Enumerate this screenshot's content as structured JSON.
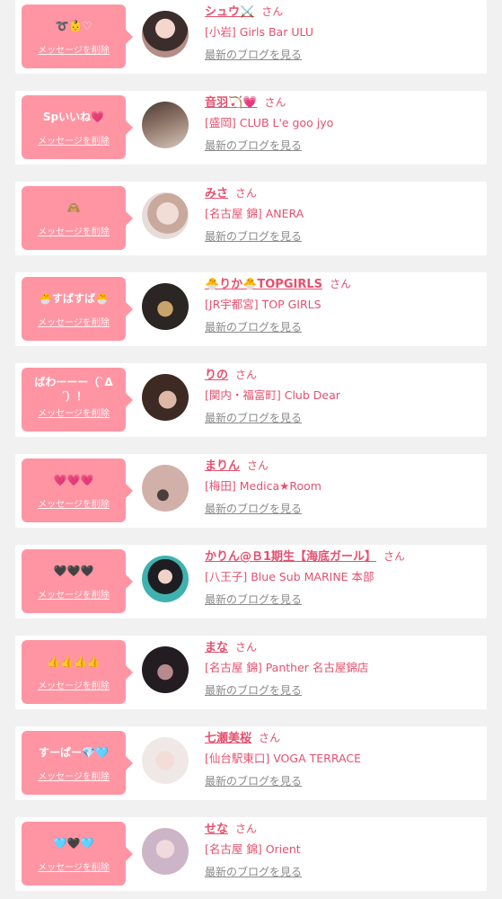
{
  "delete_label": "メッセージを削除",
  "blog_label": "最新のブログを見る",
  "honorific": "さん",
  "colors": {
    "accent": "#e5506e",
    "bubble": "#ff95a3",
    "page_bg": "#f1f1f1",
    "card_bg": "#ffffff"
  },
  "items": [
    {
      "message": "➰👶♡",
      "name": "シュウ⚔️",
      "shop": "[小岩] Girls Bar ULU"
    },
    {
      "message": "Spいいね💗",
      "name": "音羽🏹💗",
      "shop": "[盛岡] CLUB L'e goo jyo"
    },
    {
      "message": "🙈",
      "name": "みさ",
      "shop": "[名古屋 錦] ANERA"
    },
    {
      "message": "🐣すばすば🐣",
      "name": "🐣りか🐣TOPGIRLS",
      "shop": "[JR宇都宮] TOP GIRLS"
    },
    {
      "message": "ばわーーー（`Δ´）！",
      "name": "りの",
      "shop": "[関内・福富町] Club Dear"
    },
    {
      "message": "💗💗💗",
      "name": "まりん",
      "shop": "[梅田] Medica★Room"
    },
    {
      "message": "🖤🖤🖤",
      "name": "かりん@Ｂ1期生【海底ガール】",
      "shop": "[八王子] Blue Sub MARINE 本部"
    },
    {
      "message": "👍👍👍👍",
      "name": "まな",
      "shop": "[名古屋 錦] Panther 名古屋錦店"
    },
    {
      "message": "すーぱー💎🩵",
      "name": "七瀬美桜",
      "shop": "[仙台駅東口] VOGA TERRACE"
    },
    {
      "message": "🩵🖤🩵",
      "name": "せな",
      "shop": "[名古屋 錦] Orient"
    }
  ]
}
